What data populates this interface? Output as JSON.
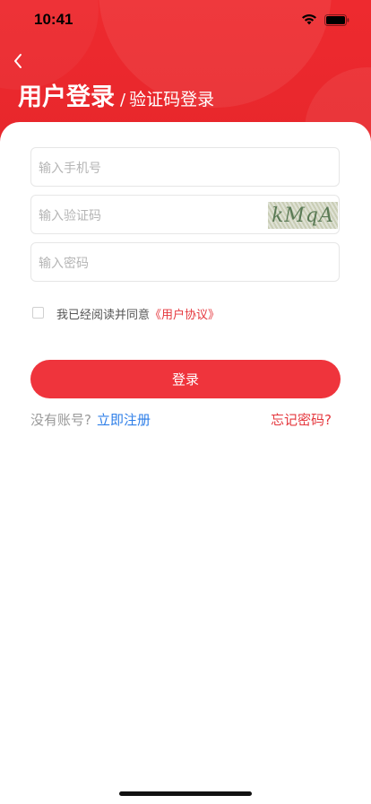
{
  "status_bar": {
    "time": "10:41"
  },
  "header": {
    "title": "用户登录",
    "separator": "/",
    "subtitle": "验证码登录"
  },
  "form": {
    "phone_placeholder": "输入手机号",
    "code_placeholder": "输入验证码",
    "captcha_text": "kMqA",
    "password_placeholder": "输入密码"
  },
  "agreement": {
    "checked": false,
    "text": "我已经阅读并同意",
    "link": "《用户协议》"
  },
  "login_button": "登录",
  "footer": {
    "no_account": "没有账号?",
    "register": "立即注册",
    "forgot": "忘记密码?"
  },
  "colors": {
    "brand_red": "#ee2a2f",
    "link_blue": "#2d7ee8",
    "accent_red": "#e5373d"
  }
}
